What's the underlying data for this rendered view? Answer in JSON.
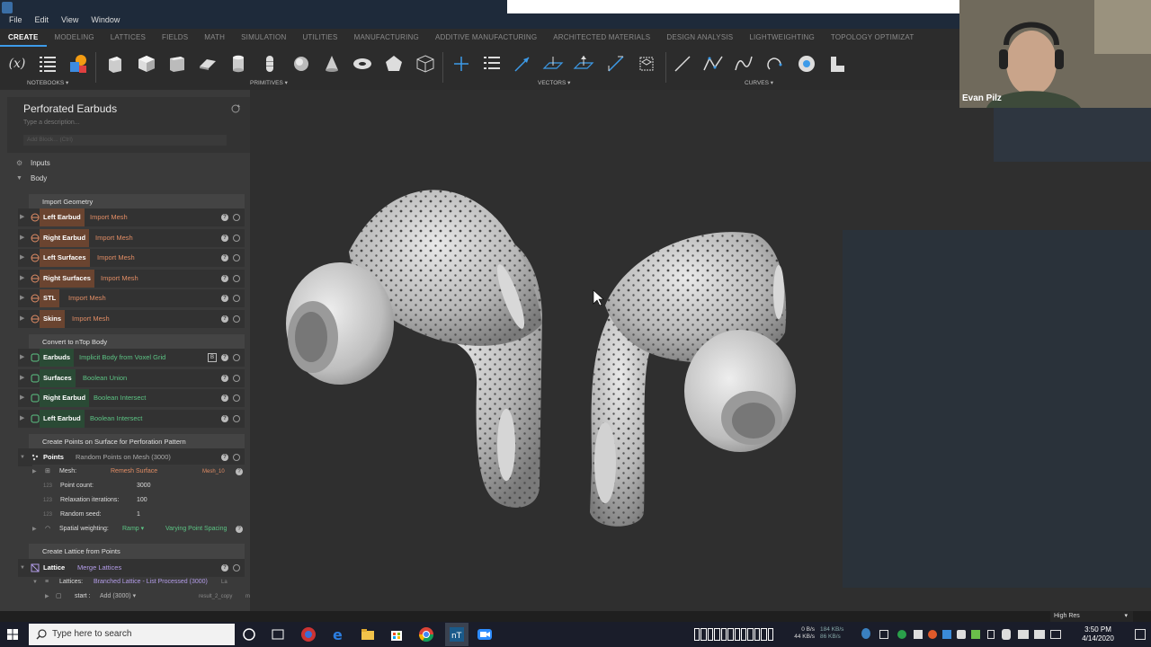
{
  "menu": {
    "items": [
      "File",
      "Edit",
      "View",
      "Window"
    ]
  },
  "ribbon_tabs": [
    "CREATE",
    "MODELING",
    "LATTICES",
    "FIELDS",
    "MATH",
    "SIMULATION",
    "UTILITIES",
    "MANUFACTURING",
    "ADDITIVE MANUFACTURING",
    "ARCHITECTED MATERIALS",
    "DESIGN ANALYSIS",
    "LIGHTWEIGHTING",
    "TOPOLOGY OPTIMIZAT"
  ],
  "toolbar": {
    "notebooks_label": "NOTEBOOKS",
    "primitives_label": "PRIMITIVES",
    "vectors_label": "VECTORS",
    "curves_label": "CURVES",
    "var_icon_text": "(x)"
  },
  "notebook": {
    "title": "Perforated Earbuds",
    "description_placeholder": "Type a description...",
    "add_block_placeholder": "Add Block... (Ctrl)",
    "inputs_label": "Inputs",
    "body_label": "Body"
  },
  "groups": {
    "import_geometry": "Import Geometry",
    "convert": "Convert to nTop Body",
    "points_group": "Create Points on Surface for Perforation Pattern",
    "lattice_group": "Create Lattice from Points"
  },
  "rows": [
    {
      "label": "Left Earbud",
      "action": "Import Mesh"
    },
    {
      "label": "Right Earbud",
      "action": "Import Mesh"
    },
    {
      "label": "Left Surfaces",
      "action": "Import Mesh"
    },
    {
      "label": "Right Surfaces",
      "action": "Import Mesh"
    },
    {
      "label": "STL",
      "action": "Import Mesh"
    },
    {
      "label": "Skins",
      "action": "Import Mesh"
    },
    {
      "label": "Earbuds",
      "action": "Implicit Body from Voxel Grid",
      "badge": "B"
    },
    {
      "label": "Surfaces",
      "action": "Boolean Union"
    },
    {
      "label": "Right Earbud",
      "action": "Boolean Intersect"
    },
    {
      "label": "Left Earbud",
      "action": "Boolean Intersect"
    },
    {
      "label": "Points",
      "action": "Random Points on Mesh (3000)"
    },
    {
      "label": "Lattice",
      "action": "Merge Lattices"
    }
  ],
  "points_params": {
    "mesh_label": "Mesh:",
    "mesh_value": "Remesh Surface",
    "mesh_ref": "Mesh_10",
    "count_label": "Point count:",
    "count_value": "3000",
    "relax_label": "Relaxation iterations:",
    "relax_value": "100",
    "seed_label": "Random seed:",
    "seed_value": "1",
    "weight_label": "Spatial weighting:",
    "weight_value": "Ramp",
    "weight_ref": "Varying Point Spacing"
  },
  "lattice_params": {
    "lattices_label": "Lattices:",
    "lattices_value": "Branched Lattice - List Processed (3000)",
    "lattices_ref": "La",
    "start_label": "start :",
    "start_value": "Add (3000)",
    "start_ref": "result_2_copy",
    "start_unit": "mm"
  },
  "webcam": {
    "name": "Evan Pilz"
  },
  "viewport": {
    "resolution": "High Res"
  },
  "taskbar": {
    "search_placeholder": "Type here to search",
    "net_up": "0 B/s",
    "net_down": "44 KB/s",
    "net_up2": "184 KB/s",
    "net_down2": "86 KB/s",
    "time": "3:50 PM",
    "date": "4/14/2020"
  }
}
